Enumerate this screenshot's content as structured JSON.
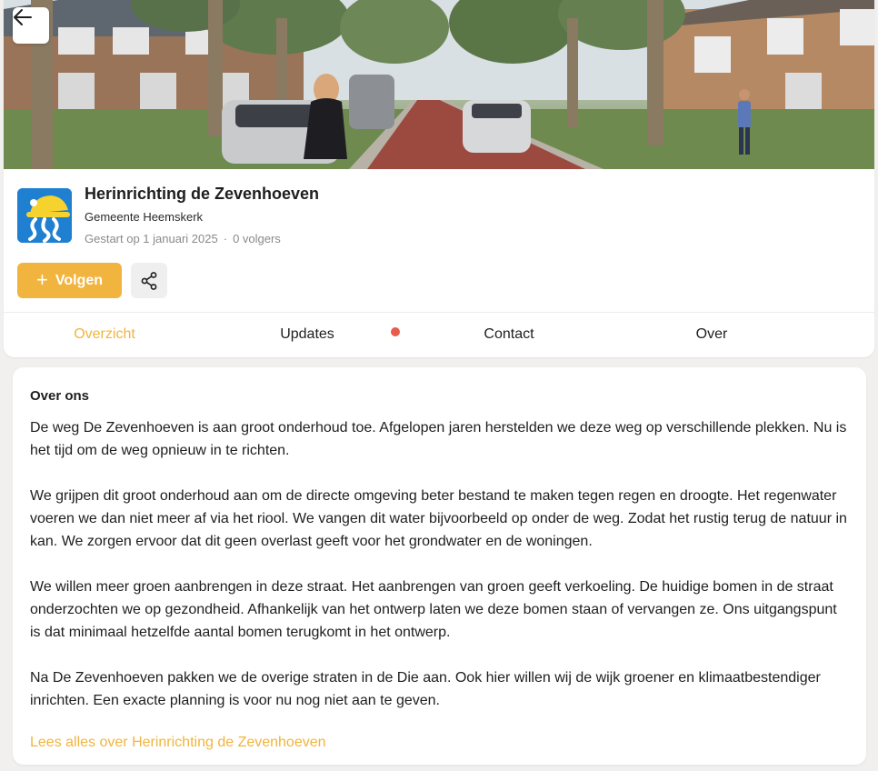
{
  "project": {
    "title": "Herinrichting de Zevenhoeven",
    "organization": "Gemeente Heemskerk",
    "started": "Gestart op 1 januari 2025",
    "followers": "0 volgers",
    "separator": "·"
  },
  "actions": {
    "follow_label": "Volgen",
    "follow_plus": "+"
  },
  "tabs": [
    {
      "label": "Overzicht",
      "active": true
    },
    {
      "label": "Updates",
      "active": false,
      "has_notification": true
    },
    {
      "label": "Contact",
      "active": false
    },
    {
      "label": "Over",
      "active": false
    }
  ],
  "about": {
    "title": "Over ons",
    "paragraphs": [
      "De weg De Zevenhoeven is aan groot onderhoud toe. Afgelopen jaren herstelden we deze weg op verschillende plekken. Nu is het tijd om de weg opnieuw in te richten.",
      "We grijpen dit groot onderhoud aan om de directe omgeving beter bestand te maken tegen regen en droogte. Het regenwater voeren we dan niet meer af via het riool. We vangen dit water bijvoorbeeld op onder de weg. Zodat het rustig terug de natuur in kan. We zorgen ervoor dat dit geen overlast geeft voor het grondwater en de woningen.",
      "We willen meer groen aanbrengen in deze straat. Het aanbrengen van groen geeft verkoeling. De huidige bomen in de straat onderzochten we op gezondheid. Afhankelijk van het ontwerp laten we deze bomen staan of vervangen ze. Ons uitgangspunt is dat minimaal hetzelfde aantal bomen terugkomt in het ontwerp.",
      "Na De Zevenhoeven pakken we de overige straten in de Die aan. Ook hier willen wij de wijk groener en klimaatbestendiger inrichten. Een exacte planning is voor nu nog niet aan te geven."
    ],
    "read_more": "Lees alles over Herinrichting de Zevenhoeven"
  },
  "icons": {
    "back": "arrow-left-icon",
    "share": "share-icon",
    "logo": "gemeente-heemskerk-logo"
  },
  "colors": {
    "accent": "#f1b43f",
    "notification": "#e85a4a",
    "logo_blue": "#1f7fd1",
    "logo_yellow": "#f5d22e"
  }
}
